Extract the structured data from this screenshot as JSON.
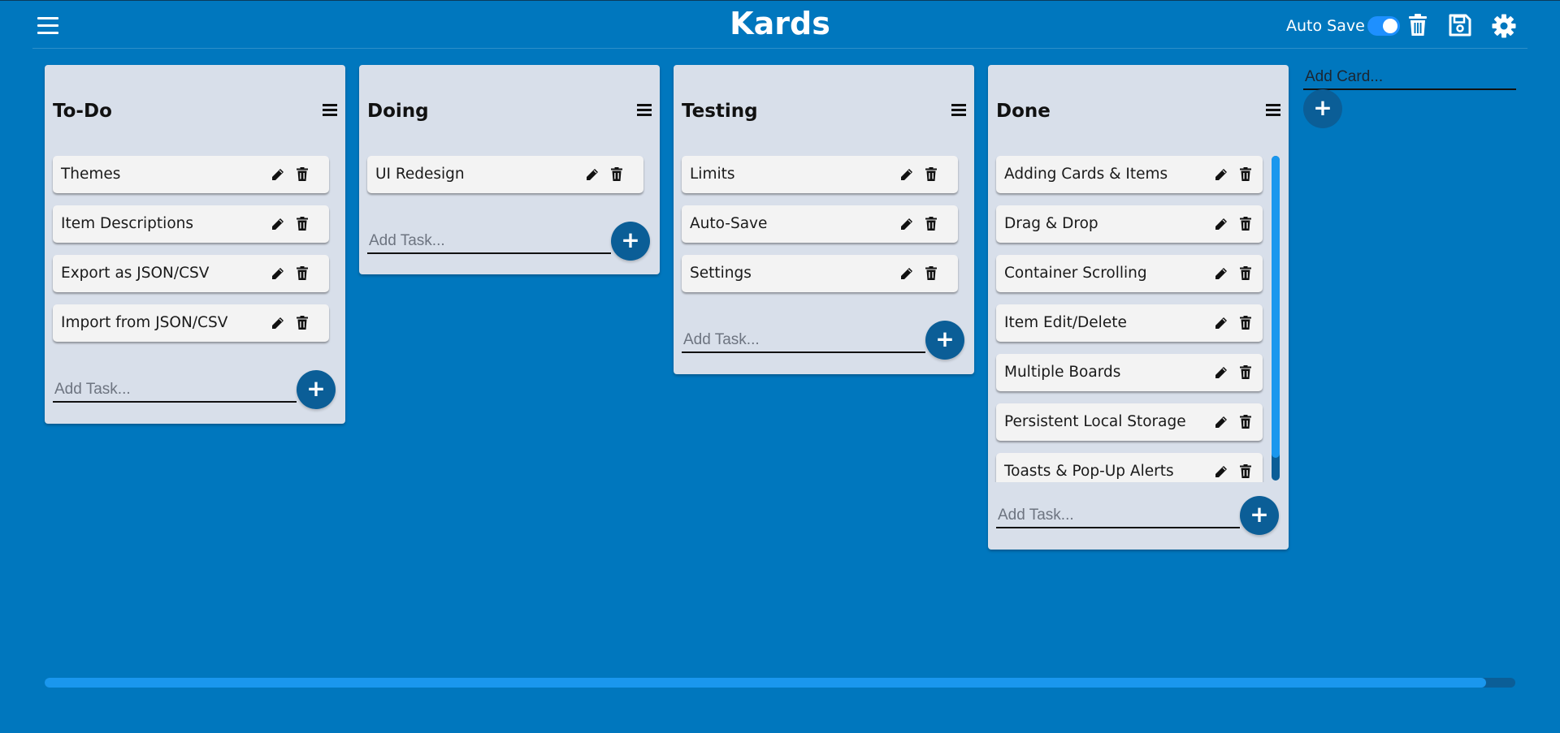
{
  "header": {
    "title": "Kards",
    "auto_save_label": "Auto Save",
    "auto_save_enabled": true
  },
  "colors": {
    "background": "#0077be",
    "card": "#d8dfea",
    "task": "#f3f3f3",
    "accent": "#0b5e97",
    "scrollbar": "#1a97ee"
  },
  "cards": [
    {
      "title": "To-Do",
      "tasks": [
        "Themes",
        "Item Descriptions",
        "Export as JSON/CSV",
        "Import from JSON/CSV"
      ],
      "add_task_placeholder": "Add Task..."
    },
    {
      "title": "Doing",
      "tasks": [
        "UI Redesign"
      ],
      "add_task_placeholder": "Add Task..."
    },
    {
      "title": "Testing",
      "tasks": [
        "Limits",
        "Auto-Save",
        "Settings"
      ],
      "add_task_placeholder": "Add Task..."
    },
    {
      "title": "Done",
      "tasks": [
        "Adding Cards & Items",
        "Drag & Drop",
        "Container Scrolling",
        "Item Edit/Delete",
        "Multiple Boards",
        "Persistent Local Storage",
        "Toasts & Pop-Up Alerts"
      ],
      "add_task_placeholder": "Add Task..."
    }
  ],
  "add_card": {
    "placeholder": "Add Card..."
  },
  "add_button_symbol": "+"
}
